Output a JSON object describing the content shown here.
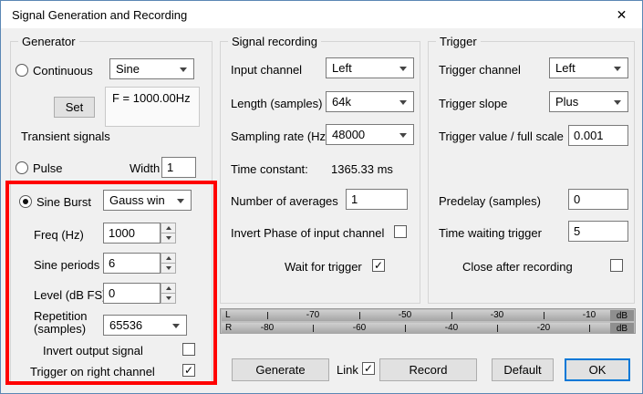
{
  "window": {
    "title": "Signal Generation and Recording"
  },
  "icons": {
    "close": "✕",
    "checkmark": "✓"
  },
  "colors": {
    "annotation": "#ff0000",
    "accent": "#0078d7"
  },
  "generator": {
    "title": "Generator",
    "continuous": {
      "label": "Continuous",
      "value": "Sine"
    },
    "set_button": "Set",
    "freq_readout": "F = 1000.00Hz",
    "transient_heading": "Transient signals",
    "pulse": {
      "label": "Pulse",
      "width_label": "Width",
      "width_value": "1"
    },
    "sine_burst": {
      "label": "Sine Burst",
      "window_value": "Gauss win",
      "freq": {
        "label": "Freq (Hz)",
        "value": "1000"
      },
      "periods": {
        "label": "Sine periods",
        "value": "6"
      },
      "level": {
        "label": "Level (dB FS)",
        "value": "0"
      },
      "repetition": {
        "label_line1": "Repetition",
        "label_line2": "(samples)",
        "value": "65536"
      },
      "invert_output_label": "Invert output signal",
      "trigger_right_label": "Trigger on right channel"
    }
  },
  "recording": {
    "title": "Signal recording",
    "input_channel": {
      "label": "Input channel",
      "value": "Left"
    },
    "length": {
      "label": "Length (samples)",
      "value": "64k"
    },
    "sampling_rate": {
      "label": "Sampling rate (Hz)",
      "value": "48000"
    },
    "time_constant": {
      "label": "Time constant:",
      "value": "1365.33 ms"
    },
    "averages": {
      "label": "Number of averages",
      "value": "1"
    },
    "invert_phase_label": "Invert Phase of input channel",
    "wait_trigger_label": "Wait for trigger"
  },
  "trigger": {
    "title": "Trigger",
    "channel": {
      "label": "Trigger channel",
      "value": "Left"
    },
    "slope": {
      "label": "Trigger slope",
      "value": "Plus"
    },
    "value": {
      "label": "Trigger value / full scale",
      "value": "0.001"
    },
    "predelay": {
      "label": "Predelay (samples)",
      "value": "0"
    },
    "waiting": {
      "label": "Time waiting trigger",
      "value": "5"
    },
    "close_after_label": "Close after recording"
  },
  "meter": {
    "left": "L",
    "right": "R",
    "unit": "dB",
    "top_labels": [
      "-70",
      "-50",
      "-30",
      "-10"
    ],
    "bottom_labels": [
      "-80",
      "-60",
      "-40",
      "-20"
    ]
  },
  "footer": {
    "generate": "Generate",
    "link_label": "Link",
    "record": "Record",
    "default": "Default",
    "ok": "OK"
  }
}
